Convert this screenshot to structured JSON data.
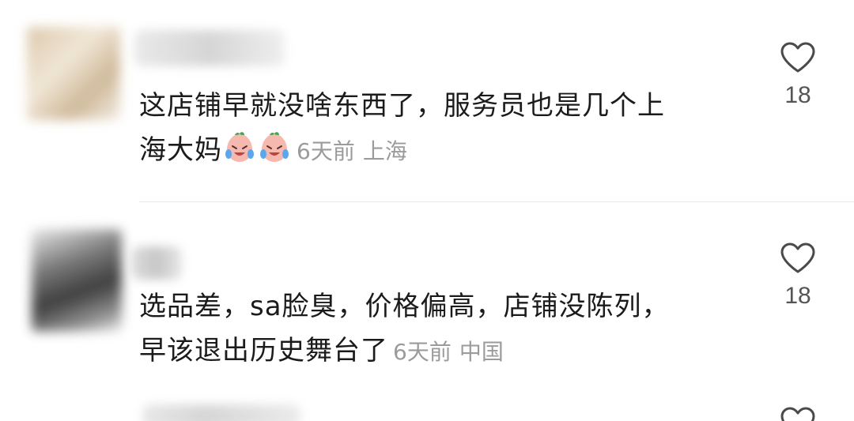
{
  "comments": [
    {
      "text_line1": "这店铺早就没啥东西了，服务员也是几个上",
      "text_line2": "海大妈",
      "emoji": [
        "crying-laughing-peach-emoji",
        "crying-laughing-peach-emoji"
      ],
      "time": "6天前",
      "location": "上海",
      "likes": "18"
    },
    {
      "text_line1": "选品差，sa脸臭，价格偏高，店铺没陈列，",
      "text_line2": "早该退出历史舞台了",
      "time": "6天前",
      "location": "中国",
      "likes": "18"
    }
  ],
  "icons": {
    "like": "heart-outline-icon",
    "emoji": "crying-laughing-peach-emoji"
  },
  "colors": {
    "text": "#1b1b1b",
    "meta": "#9b9b9b",
    "like_count": "#555555",
    "divider": "#e9e9e9"
  }
}
